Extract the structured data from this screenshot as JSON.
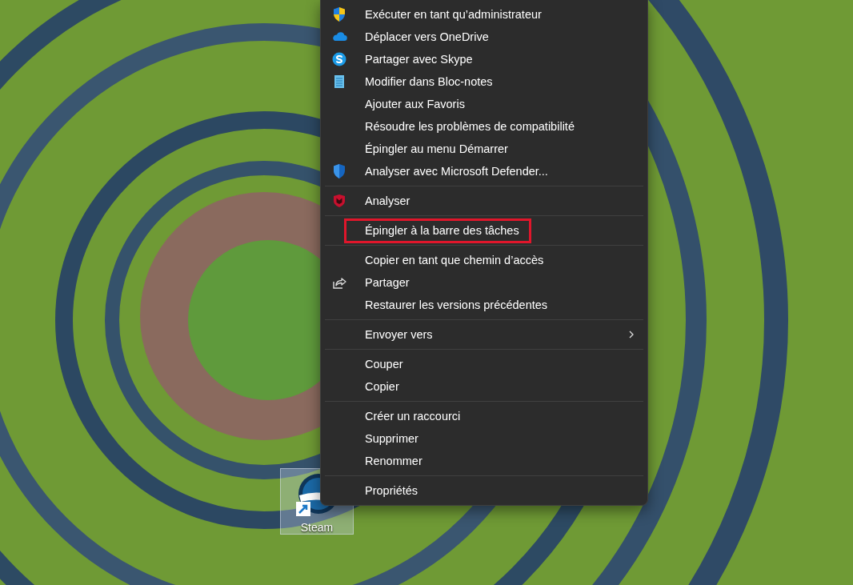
{
  "desktop": {
    "shortcuts": [
      {
        "label": "Steam",
        "selected": true
      }
    ]
  },
  "context_menu": {
    "groups": [
      {
        "items": [
          {
            "label": "Exécuter en tant qu’administrateur",
            "kind": "uac",
            "highlighted": false,
            "submenu": false
          },
          {
            "label": "Déplacer vers OneDrive",
            "kind": "cloud",
            "highlighted": false,
            "submenu": false
          },
          {
            "label": "Partager avec Skype",
            "kind": "skype",
            "highlighted": false,
            "submenu": false
          },
          {
            "label": "Modifier dans Bloc-notes",
            "kind": "notepad",
            "highlighted": false,
            "submenu": false
          },
          {
            "label": "Ajouter aux Favoris",
            "highlighted": false,
            "submenu": false
          },
          {
            "label": "Résoudre les problèmes de compatibilité",
            "highlighted": false,
            "submenu": false
          },
          {
            "label": "Épingler au menu Démarrer",
            "highlighted": false,
            "submenu": false
          },
          {
            "label": "Analyser avec Microsoft Defender...",
            "kind": "defender",
            "highlighted": false,
            "submenu": false
          }
        ]
      },
      {
        "items": [
          {
            "label": "Analyser",
            "kind": "mcafee",
            "highlighted": false,
            "submenu": false
          }
        ]
      },
      {
        "items": [
          {
            "label": "Épingler à la barre des tâches",
            "highlighted": true,
            "submenu": false
          }
        ]
      },
      {
        "items": [
          {
            "label": "Copier en tant que chemin d’accès",
            "highlighted": false,
            "submenu": false
          },
          {
            "label": "Partager",
            "kind": "share",
            "highlighted": false,
            "submenu": false
          },
          {
            "label": "Restaurer les versions précédentes",
            "highlighted": false,
            "submenu": false
          }
        ]
      },
      {
        "items": [
          {
            "label": "Envoyer vers",
            "highlighted": false,
            "submenu": true
          }
        ]
      },
      {
        "items": [
          {
            "label": "Couper",
            "highlighted": false,
            "submenu": false
          },
          {
            "label": "Copier",
            "highlighted": false,
            "submenu": false
          }
        ]
      },
      {
        "items": [
          {
            "label": "Créer un raccourci",
            "highlighted": false,
            "submenu": false
          },
          {
            "label": "Supprimer",
            "highlighted": false,
            "submenu": false
          },
          {
            "label": "Renommer",
            "highlighted": false,
            "submenu": false
          }
        ]
      },
      {
        "items": [
          {
            "label": "Propriétés",
            "highlighted": false,
            "submenu": false
          }
        ]
      }
    ]
  }
}
